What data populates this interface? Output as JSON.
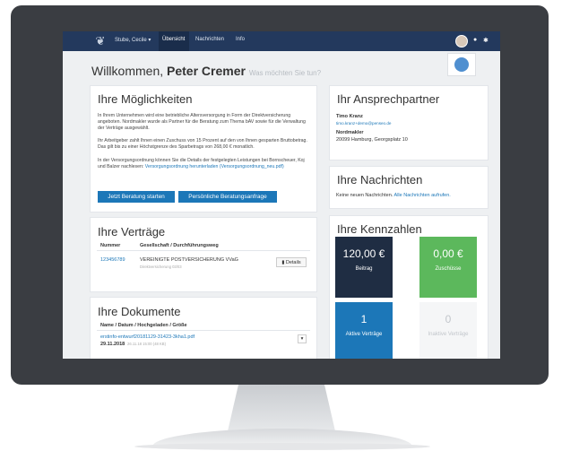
{
  "nav": {
    "user_label": "Stube, Cecile ▾",
    "items": [
      "Übersicht",
      "Nachrichten",
      "Info"
    ]
  },
  "welcome": {
    "greeting": "Willkommen,",
    "name": "Peter Cremer",
    "question": "Was möchten Sie tun?"
  },
  "options": {
    "title": "Ihre Möglichkeiten",
    "p1": "In Ihrem Unternehmen wird eine betriebliche Altersversorgung in Form der Direktversicherung angeboten. Nordmakler wurde als Partner für die Beratung zum Thema bAV sowie für die Verwaltung der Verträge ausgewählt.",
    "p2": "Ihr Arbeitgeber zahlt Ihnen einen Zuschuss von 15 Prozent auf den von Ihnen gesparten Bruttobetrag. Das gilt bis zu einer Höchstgrenze des Sparbetrags von 268,00 € monatlich.",
    "p3_start": "In der Versorgungsordnung können Sie die Details der festgelegten Leistungen bei Bornscheuer, Koj und Balzer nachlesen:",
    "p3_link": "Versorgungsordnung herunterladen (Versorgungsordnung_neu.pdf)",
    "btn_start": "Jetzt Beratung starten",
    "btn_request": "Persönliche Beratungsanfrage"
  },
  "contracts": {
    "title": "Ihre Verträge",
    "col_number": "Nummer",
    "col_company": "Gesellschaft / Durchführungsweg",
    "rows": [
      {
        "number": "123456789",
        "company": "VEREINIGTE POSTVERSICHERUNG VVaG",
        "sub": "Direktversicherung 03/03",
        "action": "Details"
      }
    ]
  },
  "documents": {
    "title": "Ihre Dokumente",
    "header": "Name / Datum / Hochgeladen / Größe",
    "items": [
      {
        "name": "erstinfo-entwurf20181129-31423-3kha1.pdf",
        "date": "29.11.2018",
        "meta": "26.11.18 15:00 (48 KB)"
      }
    ]
  },
  "contact": {
    "title": "Ihr Ansprechpartner",
    "name": "Timo Kranz",
    "email": "timo.kranz+demo@penseo.de",
    "company": "Nordmakler",
    "address": "20099 Hamburg, Georgsplatz 10"
  },
  "messages": {
    "title": "Ihre Nachrichten",
    "text": "Keine neuen Nachrichten.",
    "link": "Alle Nachrichten aufrufen."
  },
  "kpis": {
    "title": "Ihre Kennzahlen",
    "tiles": [
      {
        "value": "120,00 €",
        "label": "Beitrag",
        "color": "#1f2d43"
      },
      {
        "value": "0,00 €",
        "label": "Zuschüsse",
        "color": "#5cb85c"
      },
      {
        "value": "1",
        "label": "Aktive Verträge",
        "color": "#1c77b8"
      },
      {
        "value": "0",
        "label": "Inaktive Verträge",
        "color": "#f5f6f7"
      }
    ]
  }
}
